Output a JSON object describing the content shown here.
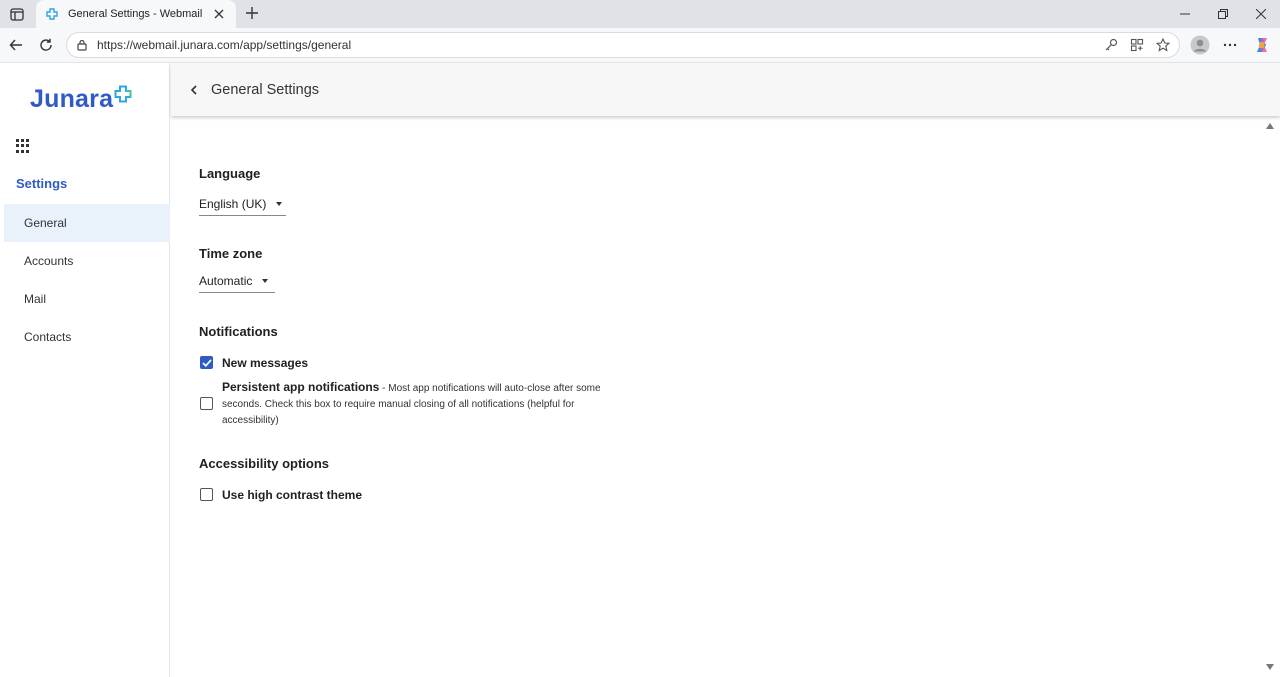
{
  "browser": {
    "tab_title": "General Settings - Webmail",
    "url": "https://webmail.junara.com/app/settings/general"
  },
  "brand": {
    "logo_text": "Junara",
    "accent_color": "#2f5bc6",
    "logo_mark_colors": [
      "#2fa4e7",
      "#3cc49a"
    ]
  },
  "sidebar": {
    "heading": "Settings",
    "items": [
      {
        "label": "General",
        "active": true
      },
      {
        "label": "Accounts",
        "active": false
      },
      {
        "label": "Mail",
        "active": false
      },
      {
        "label": "Contacts",
        "active": false
      }
    ]
  },
  "header": {
    "title": "General Settings"
  },
  "settings": {
    "language": {
      "title": "Language",
      "value": "English (UK)"
    },
    "timezone": {
      "title": "Time zone",
      "value": "Automatic"
    },
    "notifications": {
      "title": "Notifications",
      "new_messages": {
        "label": "New messages",
        "checked": true
      },
      "persistent": {
        "label": "Persistent app notifications",
        "description": " - Most app notifications will auto-close after some seconds. Check this box to require manual closing of all notifications (helpful for accessibility)",
        "checked": false
      }
    },
    "accessibility": {
      "title": "Accessibility options",
      "high_contrast": {
        "label": "Use high contrast theme",
        "checked": false
      }
    }
  }
}
